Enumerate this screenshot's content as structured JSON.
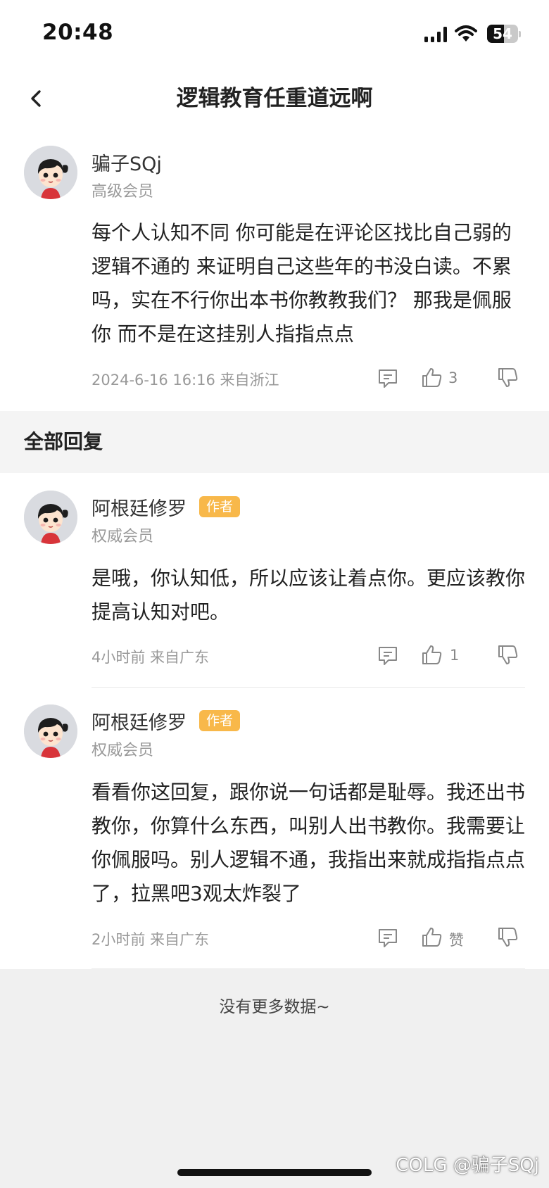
{
  "status_bar": {
    "time": "20:48",
    "battery": "54",
    "battery_level": 0.54
  },
  "nav": {
    "title": "逻辑教育任重道远啊"
  },
  "post": {
    "username": "骗子SQj",
    "member_level": "高级会员",
    "content": "每个人认知不同 你可能是在评论区找比自己弱的 逻辑不通的 来证明自己这些年的书没白读。不累吗，实在不行你出本书你教教我们？ 那我是佩服你 而不是在这挂别人指指点点",
    "meta": "2024-6-16 16:16  来自浙江",
    "likes": "3"
  },
  "section": {
    "title": "全部回复"
  },
  "replies": [
    {
      "username": "阿根廷修罗",
      "badge": "作者",
      "member_level": "权威会员",
      "content": "是哦，你认知低，所以应该让着点你。更应该教你提高认知对吧。",
      "meta": "4小时前 来自广东",
      "likes": "1"
    },
    {
      "username": "阿根廷修罗",
      "badge": "作者",
      "member_level": "权威会员",
      "content": "看看你这回复，跟你说一句话都是耻辱。我还出书教你，你算什么东西，叫别人出书教你。我需要让你佩服吗。别人逻辑不通，我指出来就成指指点点了，拉黑吧3观太炸裂了",
      "meta": "2小时前 来自广东",
      "likes": "赞"
    }
  ],
  "footer": {
    "text": "没有更多数据~",
    "watermark": "COLG @骗子SQj"
  },
  "colors": {
    "badge": "#f8b84a",
    "section_bg": "#f4f4f4"
  },
  "icons": [
    "back-icon",
    "comment-icon",
    "thumb-up-icon",
    "thumb-down-icon",
    "signal-icon",
    "wifi-icon",
    "battery-icon"
  ]
}
